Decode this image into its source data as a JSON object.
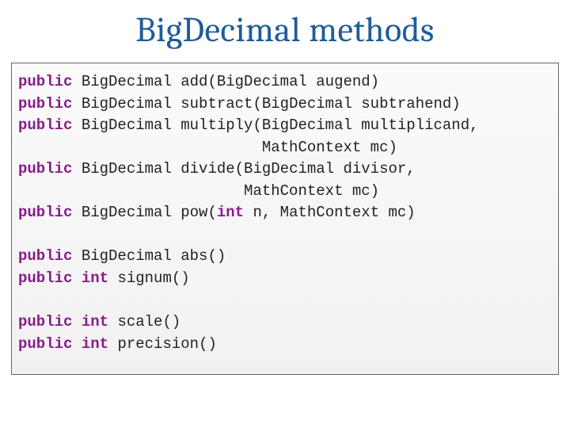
{
  "title": "BigDecimal methods",
  "code": {
    "kw_public": "public",
    "kw_int": "int",
    "l1_rest": " BigDecimal add(BigDecimal augend)",
    "l2_rest": " BigDecimal subtract(BigDecimal subtrahend)",
    "l3_rest": " BigDecimal multiply(BigDecimal multiplicand,",
    "l4": "                           MathContext mc)",
    "l5_rest": " BigDecimal divide(BigDecimal divisor,",
    "l6": "                         MathContext mc)",
    "l7_a": " BigDecimal pow(",
    "l7_b": " n, MathContext mc)",
    "l8_rest": " BigDecimal abs()",
    "l9_a": " ",
    "l9_b": " signum()",
    "l10_a": " ",
    "l10_b": " scale()",
    "l11_a": " ",
    "l11_b": " precision()"
  }
}
